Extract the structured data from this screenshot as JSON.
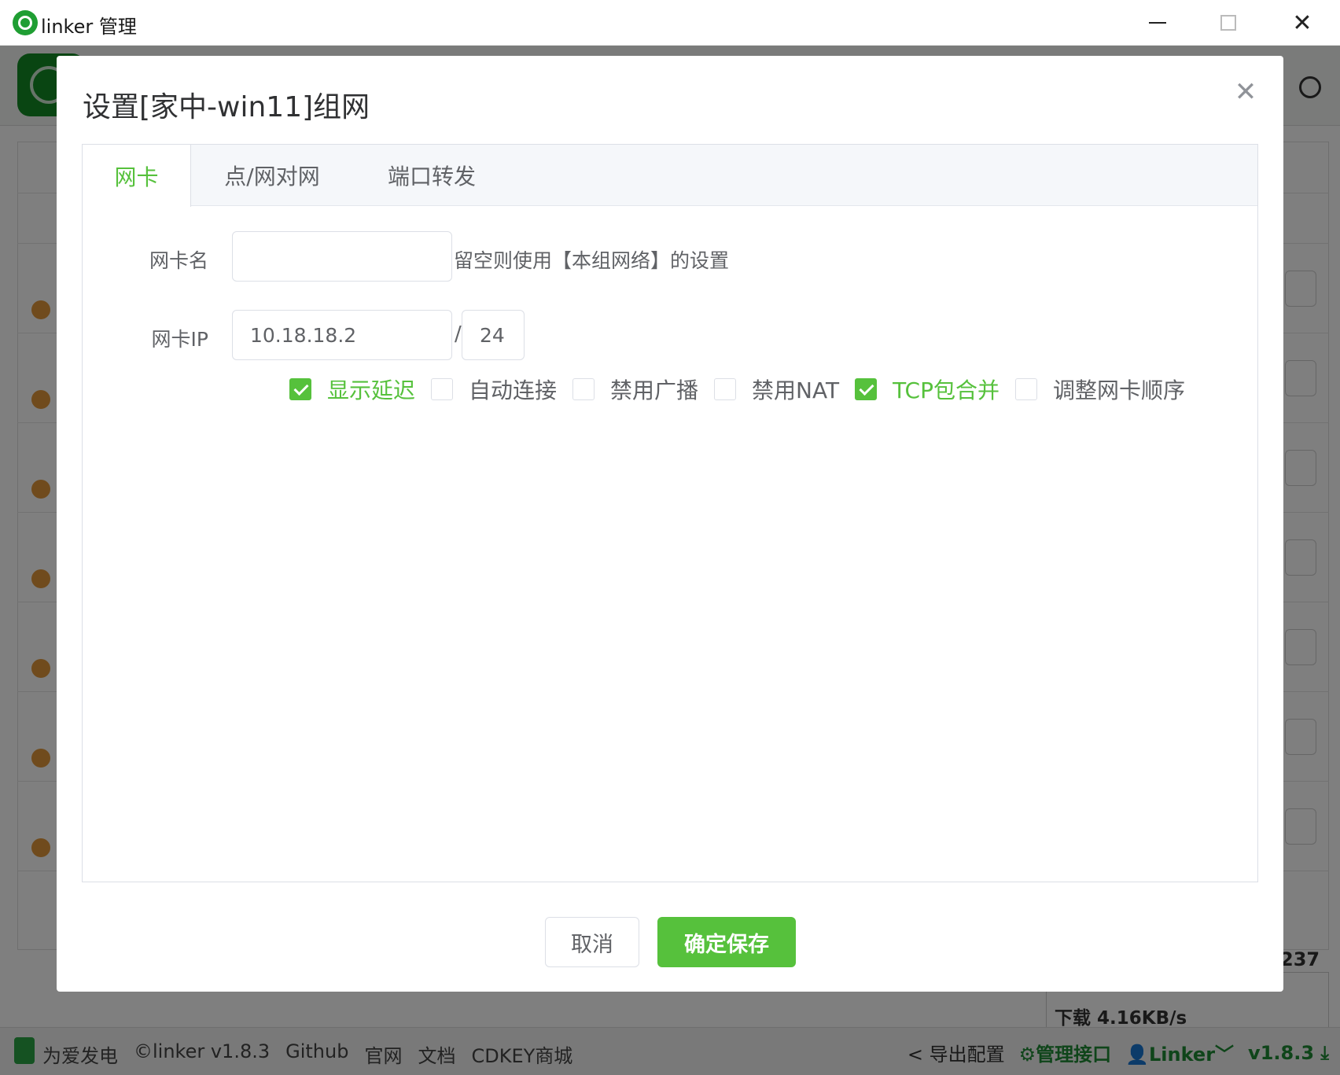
{
  "window": {
    "title": "linker 管理",
    "close_glyph": "✕",
    "icons": [
      "app-icon",
      "minimize-icon",
      "maximize-icon",
      "close-icon"
    ]
  },
  "background": {
    "counter_fragment": "237",
    "speed_down": "下载 4.16KB/s"
  },
  "footer": {
    "items_left": [
      "为爱发电",
      "©linker v1.8.3",
      "Github",
      "官网",
      "文档",
      "CDKEY商城"
    ],
    "export": "导出配置",
    "manage_api": "管理接口",
    "user": "Linker",
    "version": "v1.8.3"
  },
  "dialog": {
    "title": "设置[家中-win11]组网",
    "close_glyph": "✕",
    "tabs": [
      {
        "label": "网卡",
        "active": true
      },
      {
        "label": "点/网对网",
        "active": false
      },
      {
        "label": "端口转发",
        "active": false
      }
    ],
    "form": {
      "nic_name_label": "网卡名",
      "nic_name_value": "",
      "nic_name_hint": "留空则使用【本组网络】的设置",
      "nic_ip_label": "网卡IP",
      "nic_ip_value": "10.18.18.2",
      "slash": "/",
      "prefix_value": "24"
    },
    "checkboxes": [
      {
        "label": "显示延迟",
        "checked": true
      },
      {
        "label": "自动连接",
        "checked": false
      },
      {
        "label": "禁用广播",
        "checked": false
      },
      {
        "label": "禁用NAT",
        "checked": false
      },
      {
        "label": "TCP包合并",
        "checked": true
      },
      {
        "label": "调整网卡顺序",
        "checked": false
      }
    ],
    "buttons": {
      "cancel": "取消",
      "confirm": "确定保存"
    }
  },
  "colors": {
    "accent": "#56c13c",
    "brand_dark": "#1f9e33",
    "overlay": "rgba(0,0,0,0.5)"
  }
}
